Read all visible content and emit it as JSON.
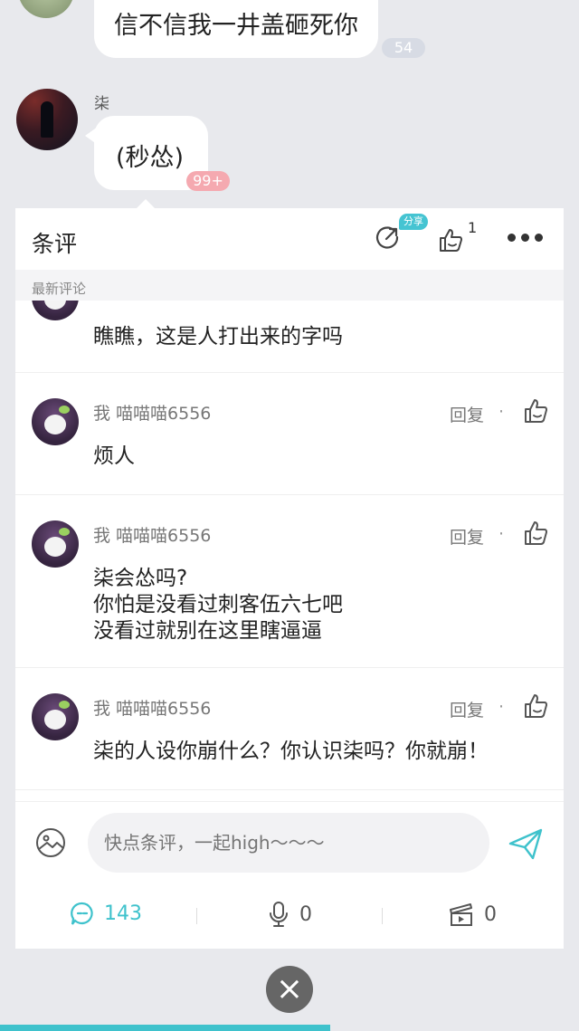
{
  "chat": {
    "msg1": {
      "text": "信不信我一井盖砸死你",
      "badge": "54"
    },
    "msg2": {
      "sender": "柒",
      "text": "(秒怂)",
      "badge": "99+"
    }
  },
  "panel": {
    "title": "条评",
    "share_tag": "分享",
    "like_count": "1",
    "section_label": "最新评论",
    "comments": [
      {
        "text": "瞧瞧，这是人打出来的字吗"
      },
      {
        "name": "我 喵喵喵6556",
        "reply": "回复",
        "dot": "·",
        "text": "烦人"
      },
      {
        "name": "我 喵喵喵6556",
        "reply": "回复",
        "dot": "·",
        "lines": [
          "柒会怂吗?",
          "你怕是没看过刺客伍六七吧",
          "没看过就别在这里瞎逼逼"
        ]
      },
      {
        "name": "我 喵喵喵6556",
        "reply": "回复",
        "dot": "·",
        "text": "柒的人设你崩什么？你认识柒吗？你就崩！"
      }
    ],
    "input_placeholder": "快点条评，一起high～～～",
    "stats": {
      "comments": "143",
      "voice": "0",
      "video": "0"
    }
  },
  "colors": {
    "accent": "#3fc2cc",
    "badge_pink": "#f5a9b0",
    "badge_grey": "#d7dbe4"
  },
  "progress": 0.57
}
